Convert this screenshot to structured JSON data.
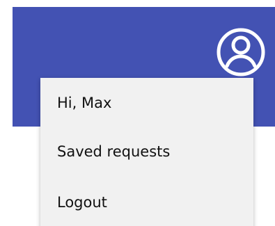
{
  "header": {
    "background_color": "#4352b3",
    "account_icon": "account-circle-icon"
  },
  "account_menu": {
    "background_color": "#f1f1f1",
    "greeting": "Hi, Max",
    "items": [
      {
        "label": "Saved requests"
      },
      {
        "label": "Logout"
      }
    ]
  }
}
